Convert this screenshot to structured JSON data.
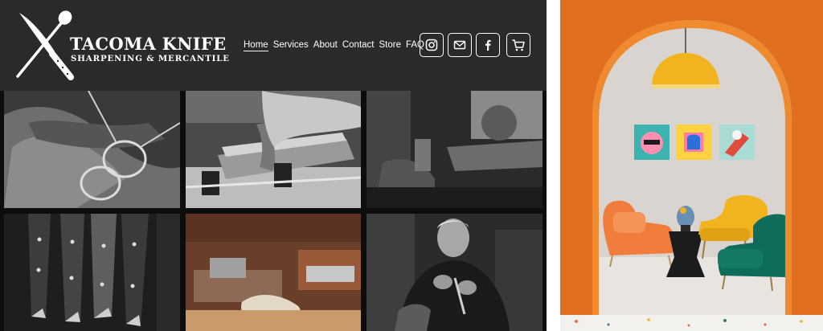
{
  "brand": {
    "title": "TACOMA KNIFE",
    "subtitle": "SHARPENING & MERCANTILE"
  },
  "nav": {
    "items": [
      {
        "label": "Home",
        "active": true
      },
      {
        "label": "Services",
        "active": false
      },
      {
        "label": "About",
        "active": false
      },
      {
        "label": "Contact",
        "active": false
      },
      {
        "label": "Store",
        "active": false
      },
      {
        "label": "FAQ",
        "active": false
      }
    ]
  },
  "social": {
    "icons": [
      "instagram-icon",
      "mail-icon",
      "facebook-icon"
    ],
    "cart_icon": "cart-icon"
  },
  "gallery": {
    "photos": [
      "glasses on work glove",
      "knife on sharpening stone",
      "bench vise",
      "row of knife handles",
      "workbench with vise and rag",
      "craftsman working on blade"
    ]
  },
  "colors": {
    "header_bg": "#2b2a2b",
    "header_text": "#ffffff",
    "wall_orange": "#e0701f",
    "lamp_yellow": "#f2b41e"
  }
}
